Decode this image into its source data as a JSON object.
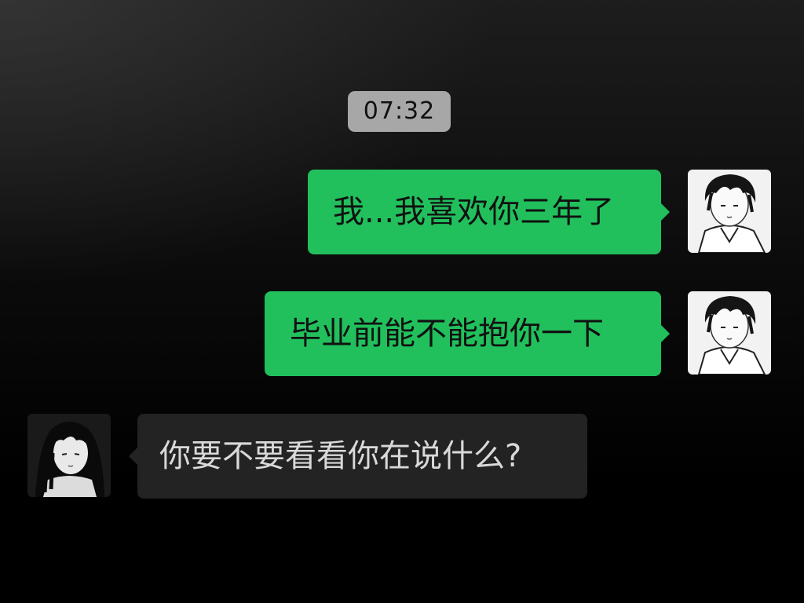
{
  "chat": {
    "timestamp": "07:32",
    "messages": [
      {
        "sender": "self",
        "avatar": "boy-avatar",
        "text": "我...我喜欢你三年了"
      },
      {
        "sender": "self",
        "avatar": "boy-avatar",
        "text": "毕业前能不能抱你一下"
      },
      {
        "sender": "other",
        "avatar": "girl-avatar",
        "text": "你要不要看看你在说什么?"
      }
    ]
  },
  "colors": {
    "outgoing_bubble": "#21c05c",
    "incoming_bubble": "#232323",
    "timestamp_pill": "#a7a7a7",
    "background": "#000000"
  }
}
